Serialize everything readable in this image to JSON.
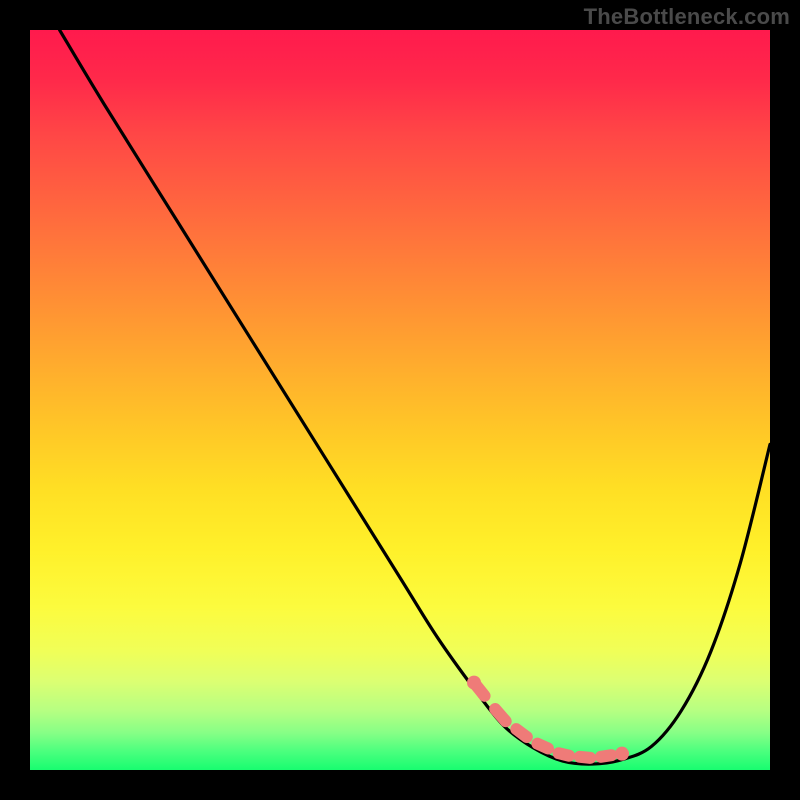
{
  "watermark": "TheBottleneck.com",
  "chart_data": {
    "type": "line",
    "title": "",
    "xlabel": "",
    "ylabel": "",
    "xlim": [
      0,
      100
    ],
    "ylim": [
      0,
      100
    ],
    "grid": false,
    "series": [
      {
        "name": "bottleneck-curve",
        "x": [
          4,
          10,
          20,
          30,
          40,
          50,
          55,
          60,
          64,
          68,
          72,
          76,
          80,
          84,
          88,
          92,
          96,
          100
        ],
        "y": [
          100,
          90,
          74,
          58,
          42,
          26,
          18,
          11,
          6,
          3,
          1.2,
          0.8,
          1.4,
          3.2,
          8,
          16,
          28,
          44
        ]
      }
    ],
    "optimal_range_x": [
      60,
      80
    ],
    "background": "heat-gradient",
    "annotations": []
  }
}
